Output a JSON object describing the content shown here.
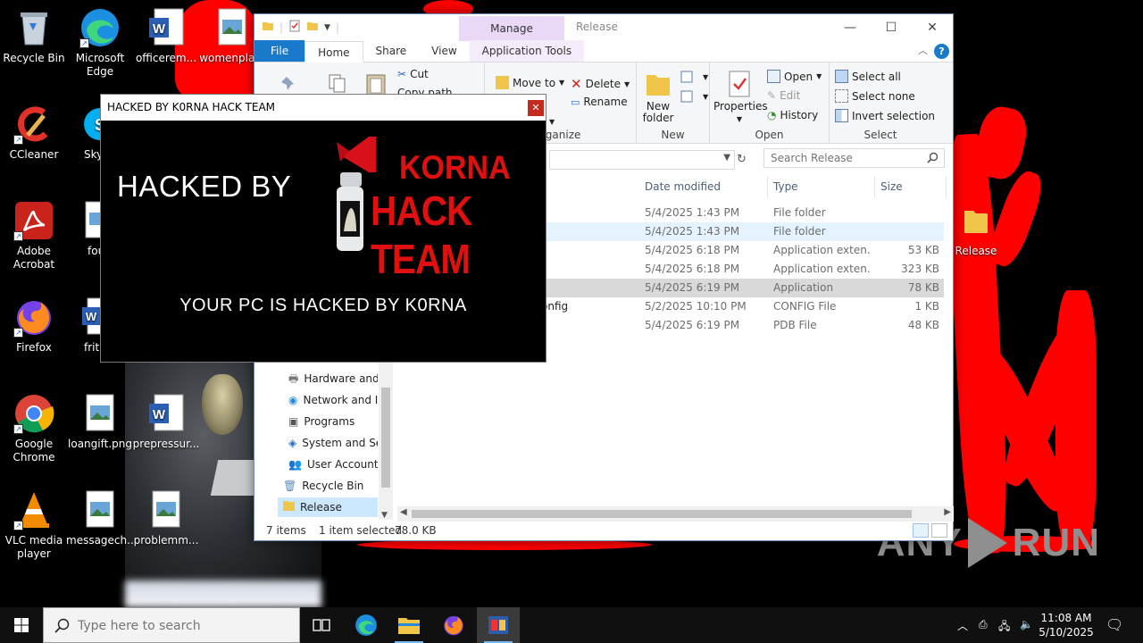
{
  "desktop": {
    "icons": [
      {
        "label": "Recycle Bin"
      },
      {
        "label": "Microsoft Edge"
      },
      {
        "label": "officerem..."
      },
      {
        "label": "womenpla..."
      },
      {
        "label": "CCleaner"
      },
      {
        "label": "Sky"
      },
      {
        "label": "Adobe Acrobat"
      },
      {
        "label": "fourin"
      },
      {
        "label": "Firefox"
      },
      {
        "label": "fritrans"
      },
      {
        "label": "Google Chrome"
      },
      {
        "label": "loangift.png"
      },
      {
        "label": "prepressur..."
      },
      {
        "label": "VLC media player"
      },
      {
        "label": "messagech..."
      },
      {
        "label": "problemm..."
      },
      {
        "label": "Release"
      }
    ],
    "watermark": "ANY RUN"
  },
  "explorer": {
    "title": "Release",
    "manage_tab": "Manage",
    "tabs": {
      "file": "File",
      "home": "Home",
      "share": "Share",
      "view": "View",
      "app_tools": "Application Tools"
    },
    "ribbon": {
      "cut": "Cut",
      "copy_path": "Copy path",
      "organize_label": "Organize",
      "move_to": "Move to",
      "delete": "Delete",
      "rename": "Rename",
      "new_folder": "New folder",
      "new_label": "New",
      "properties": "Properties",
      "open": "Open",
      "edit": "Edit",
      "history": "History",
      "open_label": "Open",
      "select_all": "Select all",
      "select_none": "Select none",
      "invert_selection": "Invert selection",
      "select_label": "Select"
    },
    "search_placeholder": "Search Release",
    "columns": {
      "date": "Date modified",
      "type": "Type",
      "size": "Size"
    },
    "files": [
      {
        "name": "",
        "date": "5/4/2025 1:43 PM",
        "type": "File folder",
        "size": ""
      },
      {
        "name": "",
        "date": "5/4/2025 1:43 PM",
        "type": "File folder",
        "size": ""
      },
      {
        "name": "",
        "date": "5/4/2025 6:18 PM",
        "type": "Application exten...",
        "size": "53 KB"
      },
      {
        "name": "",
        "date": "5/4/2025 6:18 PM",
        "type": "Application exten...",
        "size": "323 KB"
      },
      {
        "name": "",
        "date": "5/4/2025 6:19 PM",
        "type": "Application",
        "size": "78 KB"
      },
      {
        "name": "onfig",
        "date": "5/2/2025 10:10 PM",
        "type": "CONFIG File",
        "size": "1 KB"
      },
      {
        "name": "",
        "date": "5/4/2025 6:19 PM",
        "type": "PDB File",
        "size": "48 KB"
      }
    ],
    "nav": [
      {
        "label": "Hardware and"
      },
      {
        "label": "Network and In"
      },
      {
        "label": "Programs"
      },
      {
        "label": "System and Sec"
      },
      {
        "label": "User Accounts"
      },
      {
        "label": "Recycle Bin"
      },
      {
        "label": "Release"
      }
    ],
    "status": {
      "items": "7 items",
      "selected": "1 item selected",
      "size": "78.0 KB"
    }
  },
  "hack_window": {
    "title": "HACKED BY K0RNA HACK TEAM",
    "headline": "HACKED BY",
    "logo_line1": "KORNA",
    "logo_line2": "HACK TEAM",
    "message": "YOUR PC IS HACKED BY K0RNA"
  },
  "taskbar": {
    "search_placeholder": "Type here to search",
    "time": "11:08 AM",
    "date": "5/10/2025"
  },
  "colors": {
    "file_tab": "#1979ca",
    "manage_tab": "#e9d9f6",
    "hack_red": "#e01010",
    "paint_red": "#ff0000"
  }
}
